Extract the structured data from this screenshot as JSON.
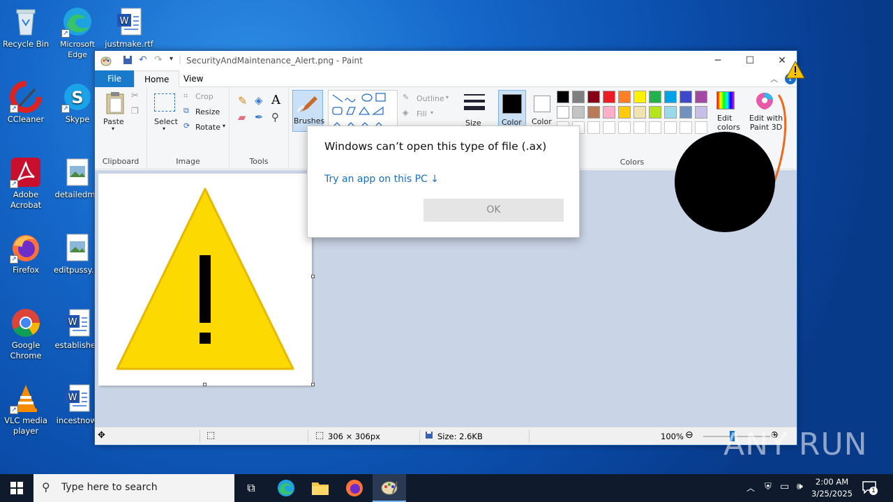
{
  "desktop": {
    "icons": [
      {
        "label": "Recycle Bin"
      },
      {
        "label": "Microsoft Edge"
      },
      {
        "label": "justmake.rtf"
      },
      {
        "label": "CCleaner"
      },
      {
        "label": "Skype"
      },
      {
        "label": "Adobe Acrobat"
      },
      {
        "label": "detailedma"
      },
      {
        "label": "Firefox"
      },
      {
        "label": "editpussy.jp"
      },
      {
        "label": "Google Chrome"
      },
      {
        "label": "establishec"
      },
      {
        "label": "VLC media player"
      },
      {
        "label": "incestnow."
      }
    ]
  },
  "paint": {
    "title": "SecurityAndMaintenance_Alert.png - Paint",
    "tabs": [
      "File",
      "Home",
      "View"
    ],
    "ribbon": {
      "clipboard": {
        "paste": "Paste",
        "group": "Clipboard"
      },
      "image": {
        "select": "Select",
        "crop": "Crop",
        "resize": "Resize",
        "rotate": "Rotate",
        "group": "Image"
      },
      "tools": {
        "group": "Tools"
      },
      "brushes": "Brushes",
      "shapes": {
        "outline": "Outline",
        "fill": "Fill"
      },
      "size": "Size",
      "color1": "Color",
      "color2": "Color",
      "colors_group": "Colors",
      "edit_colors": "Edit colors",
      "edit_paint3d": "Edit with Paint 3D",
      "palette_row1": [
        "#000000",
        "#7f7f7f",
        "#880015",
        "#ed1c24",
        "#ff7f27",
        "#fff200",
        "#22b14c",
        "#00a2e8",
        "#3f48cc",
        "#a349a4"
      ],
      "palette_row2": [
        "#ffffff",
        "#c3c3c3",
        "#b97a57",
        "#ffaec9",
        "#ffc90e",
        "#efe4b0",
        "#b5e61d",
        "#99d9ea",
        "#7092be",
        "#c8bfe7"
      ]
    },
    "status": {
      "dimensions": "306 × 306px",
      "size": "Size: 2.6KB",
      "zoom": "100%"
    }
  },
  "dialog": {
    "title": "Windows can’t open this type of file (.ax)",
    "link": "Try an app on this PC ↓",
    "ok": "OK"
  },
  "taskbar": {
    "search_placeholder": "Type here to search",
    "time": "2:00 AM",
    "date": "3/25/2025",
    "notification_count": "1"
  },
  "watermark": "ANY RUN"
}
